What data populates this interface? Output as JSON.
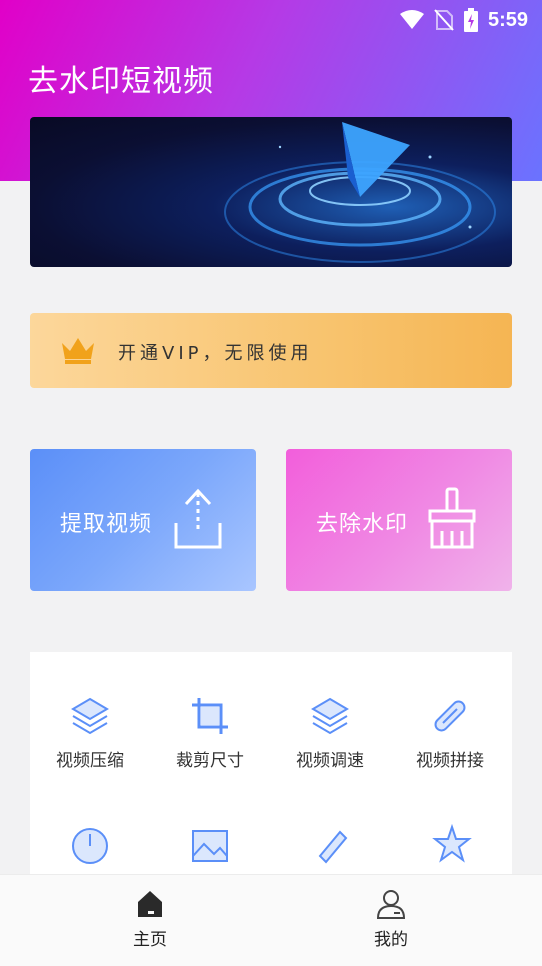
{
  "status_bar": {
    "time": "5:59",
    "icons": [
      "wifi-icon",
      "no-sim-icon",
      "battery-icon"
    ]
  },
  "app": {
    "title": "去水印短视频"
  },
  "vip": {
    "text": "开通VIP，无限使用",
    "icon": "crown-icon"
  },
  "actions": [
    {
      "label": "提取视频",
      "icon": "upload-icon"
    },
    {
      "label": "去除水印",
      "icon": "broom-icon"
    }
  ],
  "tools": [
    {
      "label": "视频压缩",
      "icon": "layers-icon"
    },
    {
      "label": "裁剪尺寸",
      "icon": "crop-icon"
    },
    {
      "label": "视频调速",
      "icon": "layers-icon"
    },
    {
      "label": "视频拼接",
      "icon": "paperclip-icon"
    }
  ],
  "tools_row2_icons": [
    "clock-icon",
    "image-icon",
    "pen-icon",
    "star-icon"
  ],
  "nav": [
    {
      "label": "主页",
      "icon": "home-icon"
    },
    {
      "label": "我的",
      "icon": "user-icon"
    }
  ],
  "colors": {
    "accent_blue": "#5b8ff8",
    "accent_pink": "#f25edb",
    "header_start": "#e100c8",
    "header_end": "#6a73ff",
    "vip_gold": "#f5b553"
  }
}
